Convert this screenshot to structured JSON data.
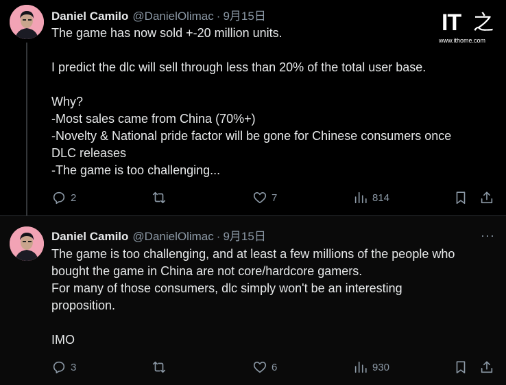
{
  "watermark": {
    "brand": "IT之家",
    "logo_mark": "IT",
    "logo_glyph": "之",
    "url": "www.ithome.com"
  },
  "colors": {
    "background": "#000000",
    "text": "#e7e9ea",
    "muted": "#8b98a5",
    "divider": "#2f3336"
  },
  "tweets": [
    {
      "author": {
        "name": "Daniel Camilo",
        "handle": "@DanielOlimac",
        "separator": "·",
        "date": "9月15日"
      },
      "lines": [
        "The game has now sold +-20 million units.",
        "",
        "I predict the dlc will sell through less than 20% of the total user base.",
        "",
        "Why?",
        "-Most sales came from China (70%+)",
        "-Novelty & National pride factor will be gone for Chinese consumers once",
        "DLC releases",
        "-The game is too challenging..."
      ],
      "stats": {
        "replies": "2",
        "retweets": "",
        "likes": "7",
        "views": "814"
      },
      "icons": [
        "reply-icon",
        "retweet-icon",
        "like-icon",
        "views-icon",
        "bookmark-icon",
        "share-icon"
      ]
    },
    {
      "author": {
        "name": "Daniel Camilo",
        "handle": "@DanielOlimac",
        "separator": "·",
        "date": "9月15日"
      },
      "more": "···",
      "lines": [
        "The game is too challenging, and at least a few millions of the people who",
        "bought the game in China are not core/hardcore gamers.",
        "For many of those consumers, dlc simply won't be an interesting",
        "proposition.",
        "",
        "IMO"
      ],
      "stats": {
        "replies": "3",
        "retweets": "",
        "likes": "6",
        "views": "930"
      },
      "icons": [
        "reply-icon",
        "retweet-icon",
        "like-icon",
        "views-icon",
        "bookmark-icon",
        "share-icon"
      ]
    }
  ]
}
